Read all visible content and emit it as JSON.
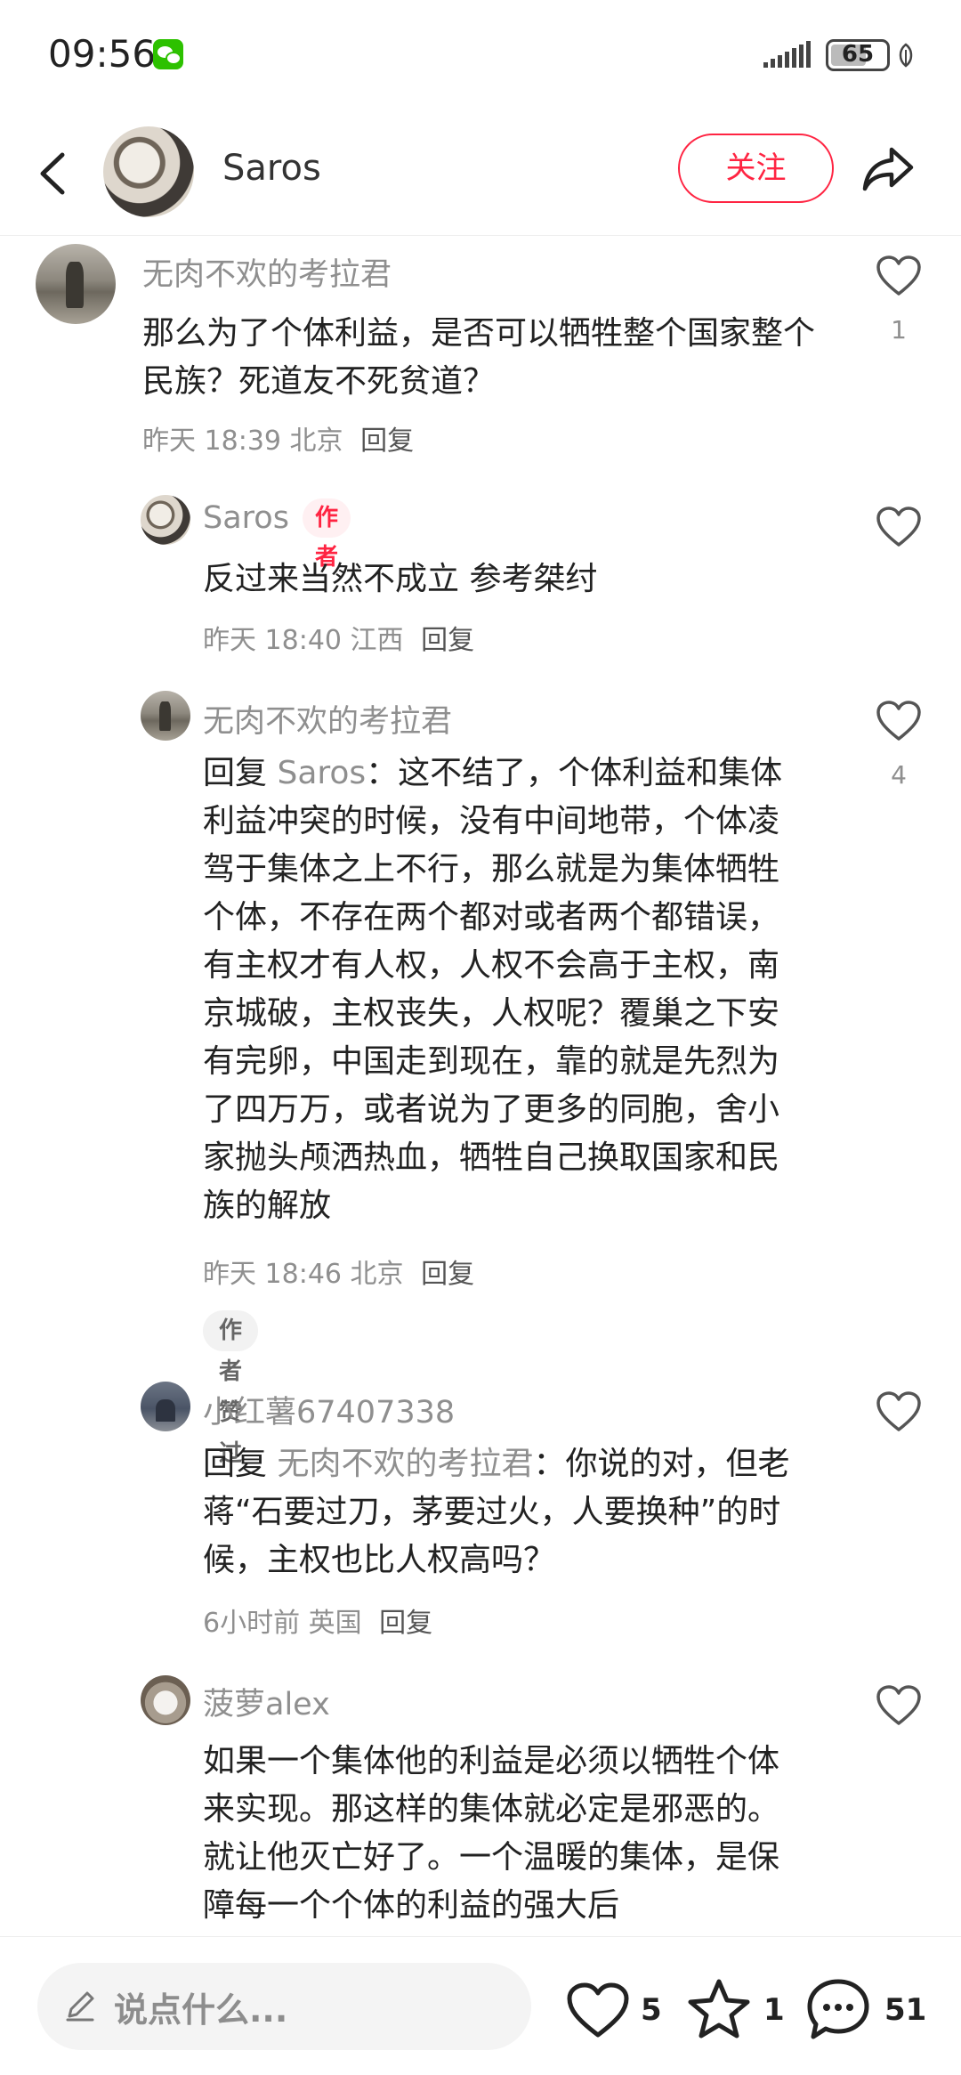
{
  "status_bar": {
    "time": "09:56",
    "battery": "65",
    "battery_level": 0.65
  },
  "header": {
    "name": "Saros",
    "follow_label": "关注"
  },
  "comments": [
    {
      "author": "无肉不欢的考拉君",
      "text": "那么为了个体利益，是否可以牺牲整个国家整个民族？死道友不死贫道？",
      "meta": "昨天 18:39 北京",
      "reply_label": "回复",
      "likes": "1"
    },
    {
      "author": "Saros",
      "author_tag": "作者",
      "text": "反过来当然不成立 参考桀纣",
      "meta": "昨天 18:40 江西",
      "reply_label": "回复"
    },
    {
      "author": "无肉不欢的考拉君",
      "reply_prefix": "回复",
      "reply_target": "Saros",
      "text": "：这不结了，个体利益和集体利益冲突的时候，没有中间地带，个体凌驾于集体之上不行，那么就是为集体牺牲个体，不存在两个都对或者两个都错误，有主权才有人权，人权不会高于主权，南京城破，主权丧失，人权呢？覆巢之下安有完卵，中国走到现在，靠的就是先烈为了四万万，或者说为了更多的同胞，舍小家抛头颅洒热血，牺牲自己换取国家和民族的解放",
      "meta": "昨天 18:46 北京",
      "reply_label": "回复",
      "likes": "4",
      "badge": "作者赞过"
    },
    {
      "author": "小红薯67407338",
      "reply_prefix": "回复",
      "reply_target": "无肉不欢的考拉君",
      "text": "：你说的对，但老蒋“石要过刀，茅要过火，人要换种”的时候，主权也比人权高吗？",
      "meta": "6小时前 英国",
      "reply_label": "回复"
    },
    {
      "author": "菠萝alex",
      "text": "如果一个集体他的利益是必须以牺牲个体来实现。那这样的集体就必定是邪恶的。就让他灭亡好了。一个温暖的集体，是保障每一个个体的利益的强大后"
    }
  ],
  "bottom_bar": {
    "placeholder": "说点什么...",
    "likes": "5",
    "collects": "1",
    "comments": "51"
  }
}
